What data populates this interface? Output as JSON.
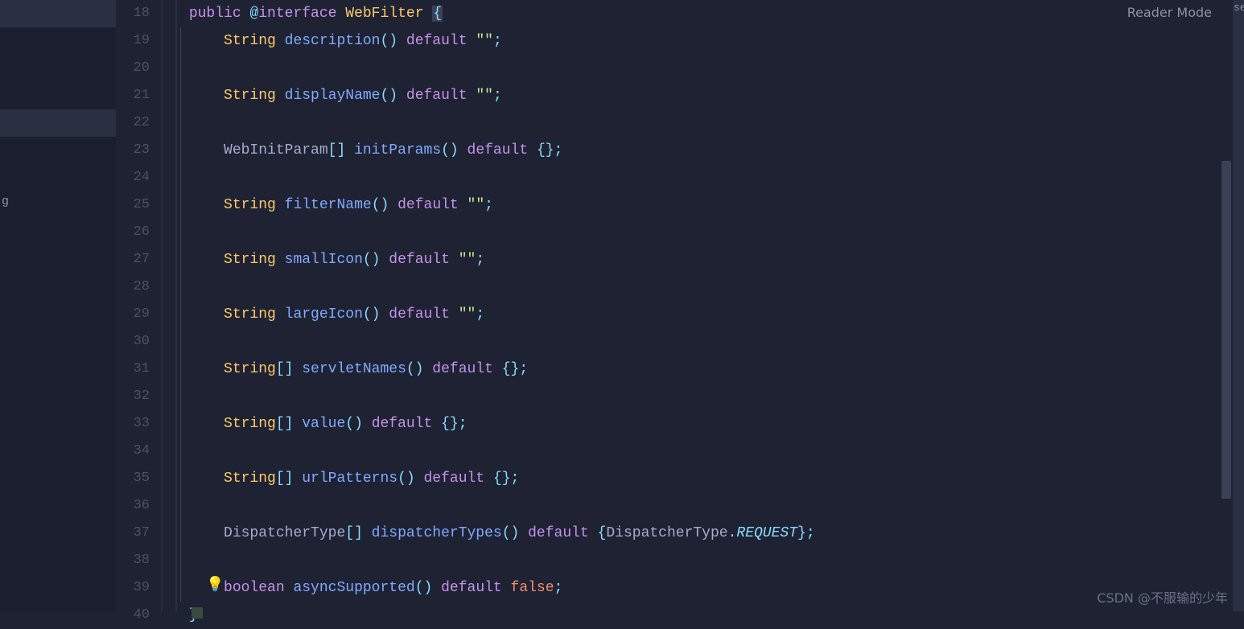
{
  "reader_mode_label": "Reader Mode",
  "watermark": "CSDN @不服输的少年",
  "sidebar_partial_text": "g",
  "right_strip_text": "se",
  "gutter": {
    "start": 18,
    "end": 40
  },
  "lines": [
    {
      "n": 18,
      "indent": 0,
      "tokens": [
        {
          "t": "public ",
          "c": "kw"
        },
        {
          "t": "@",
          "c": "punct"
        },
        {
          "t": "interface ",
          "c": "kw"
        },
        {
          "t": "WebFilter ",
          "c": "typename"
        },
        {
          "t": "{",
          "c": "punct caret-highlight"
        }
      ]
    },
    {
      "n": 19,
      "indent": 1,
      "tokens": [
        {
          "t": "    ",
          "c": ""
        },
        {
          "t": "String ",
          "c": "type"
        },
        {
          "t": "description",
          "c": "method"
        },
        {
          "t": "()",
          "c": "punct"
        },
        {
          "t": " ",
          "c": ""
        },
        {
          "t": "default ",
          "c": "kw"
        },
        {
          "t": "\"\"",
          "c": "str"
        },
        {
          "t": ";",
          "c": "punct"
        }
      ]
    },
    {
      "n": 20,
      "indent": 1,
      "tokens": []
    },
    {
      "n": 21,
      "indent": 1,
      "tokens": [
        {
          "t": "    ",
          "c": ""
        },
        {
          "t": "String ",
          "c": "type"
        },
        {
          "t": "displayName",
          "c": "method"
        },
        {
          "t": "()",
          "c": "punct"
        },
        {
          "t": " ",
          "c": ""
        },
        {
          "t": "default ",
          "c": "kw"
        },
        {
          "t": "\"\"",
          "c": "str"
        },
        {
          "t": ";",
          "c": "punct"
        }
      ]
    },
    {
      "n": 22,
      "indent": 1,
      "tokens": []
    },
    {
      "n": 23,
      "indent": 1,
      "tokens": [
        {
          "t": "    ",
          "c": ""
        },
        {
          "t": "WebInitParam",
          "c": "plain"
        },
        {
          "t": "[] ",
          "c": "punct"
        },
        {
          "t": "initParams",
          "c": "method"
        },
        {
          "t": "()",
          "c": "punct"
        },
        {
          "t": " ",
          "c": ""
        },
        {
          "t": "default ",
          "c": "kw"
        },
        {
          "t": "{}",
          "c": "punct"
        },
        {
          "t": ";",
          "c": "punct"
        }
      ]
    },
    {
      "n": 24,
      "indent": 1,
      "tokens": []
    },
    {
      "n": 25,
      "indent": 1,
      "tokens": [
        {
          "t": "    ",
          "c": ""
        },
        {
          "t": "String ",
          "c": "type"
        },
        {
          "t": "filterName",
          "c": "method"
        },
        {
          "t": "()",
          "c": "punct"
        },
        {
          "t": " ",
          "c": ""
        },
        {
          "t": "default ",
          "c": "kw"
        },
        {
          "t": "\"\"",
          "c": "str"
        },
        {
          "t": ";",
          "c": "punct"
        }
      ]
    },
    {
      "n": 26,
      "indent": 1,
      "tokens": []
    },
    {
      "n": 27,
      "indent": 1,
      "tokens": [
        {
          "t": "    ",
          "c": ""
        },
        {
          "t": "String ",
          "c": "type"
        },
        {
          "t": "smallIcon",
          "c": "method"
        },
        {
          "t": "()",
          "c": "punct"
        },
        {
          "t": " ",
          "c": ""
        },
        {
          "t": "default ",
          "c": "kw"
        },
        {
          "t": "\"\"",
          "c": "str"
        },
        {
          "t": ";",
          "c": "punct"
        }
      ]
    },
    {
      "n": 28,
      "indent": 1,
      "tokens": []
    },
    {
      "n": 29,
      "indent": 1,
      "tokens": [
        {
          "t": "    ",
          "c": ""
        },
        {
          "t": "String ",
          "c": "type"
        },
        {
          "t": "largeIcon",
          "c": "method"
        },
        {
          "t": "()",
          "c": "punct"
        },
        {
          "t": " ",
          "c": ""
        },
        {
          "t": "default ",
          "c": "kw"
        },
        {
          "t": "\"\"",
          "c": "str"
        },
        {
          "t": ";",
          "c": "punct"
        }
      ]
    },
    {
      "n": 30,
      "indent": 1,
      "tokens": []
    },
    {
      "n": 31,
      "indent": 1,
      "tokens": [
        {
          "t": "    ",
          "c": ""
        },
        {
          "t": "String",
          "c": "type"
        },
        {
          "t": "[] ",
          "c": "punct"
        },
        {
          "t": "servletNames",
          "c": "method"
        },
        {
          "t": "()",
          "c": "punct"
        },
        {
          "t": " ",
          "c": ""
        },
        {
          "t": "default ",
          "c": "kw"
        },
        {
          "t": "{}",
          "c": "punct"
        },
        {
          "t": ";",
          "c": "punct"
        }
      ]
    },
    {
      "n": 32,
      "indent": 1,
      "tokens": []
    },
    {
      "n": 33,
      "indent": 1,
      "tokens": [
        {
          "t": "    ",
          "c": ""
        },
        {
          "t": "String",
          "c": "type"
        },
        {
          "t": "[] ",
          "c": "punct"
        },
        {
          "t": "value",
          "c": "method"
        },
        {
          "t": "()",
          "c": "punct"
        },
        {
          "t": " ",
          "c": ""
        },
        {
          "t": "default ",
          "c": "kw"
        },
        {
          "t": "{}",
          "c": "punct"
        },
        {
          "t": ";",
          "c": "punct"
        }
      ]
    },
    {
      "n": 34,
      "indent": 1,
      "tokens": []
    },
    {
      "n": 35,
      "indent": 1,
      "tokens": [
        {
          "t": "    ",
          "c": ""
        },
        {
          "t": "String",
          "c": "type"
        },
        {
          "t": "[] ",
          "c": "punct"
        },
        {
          "t": "urlPatterns",
          "c": "method"
        },
        {
          "t": "()",
          "c": "punct"
        },
        {
          "t": " ",
          "c": ""
        },
        {
          "t": "default ",
          "c": "kw"
        },
        {
          "t": "{}",
          "c": "punct"
        },
        {
          "t": ";",
          "c": "punct"
        }
      ]
    },
    {
      "n": 36,
      "indent": 1,
      "tokens": []
    },
    {
      "n": 37,
      "indent": 1,
      "tokens": [
        {
          "t": "    ",
          "c": ""
        },
        {
          "t": "DispatcherType",
          "c": "plain"
        },
        {
          "t": "[] ",
          "c": "punct"
        },
        {
          "t": "dispatcherTypes",
          "c": "method"
        },
        {
          "t": "()",
          "c": "punct"
        },
        {
          "t": " ",
          "c": ""
        },
        {
          "t": "default ",
          "c": "kw"
        },
        {
          "t": "{",
          "c": "punct"
        },
        {
          "t": "DispatcherType",
          "c": "plain"
        },
        {
          "t": ".",
          "c": "punct"
        },
        {
          "t": "REQUEST",
          "c": "enum"
        },
        {
          "t": "}",
          "c": "punct"
        },
        {
          "t": ";",
          "c": "punct"
        }
      ]
    },
    {
      "n": 38,
      "indent": 1,
      "tokens": []
    },
    {
      "n": 39,
      "indent": 1,
      "tokens": [
        {
          "t": "    ",
          "c": ""
        },
        {
          "t": "boolean ",
          "c": "kw"
        },
        {
          "t": "asyncSupported",
          "c": "method"
        },
        {
          "t": "()",
          "c": "punct"
        },
        {
          "t": " ",
          "c": ""
        },
        {
          "t": "default ",
          "c": "kw"
        },
        {
          "t": "false",
          "c": "bool"
        },
        {
          "t": ";",
          "c": "punct"
        }
      ]
    },
    {
      "n": 40,
      "indent": 0,
      "tokens": [
        {
          "t": "}",
          "c": "punct"
        }
      ]
    }
  ]
}
